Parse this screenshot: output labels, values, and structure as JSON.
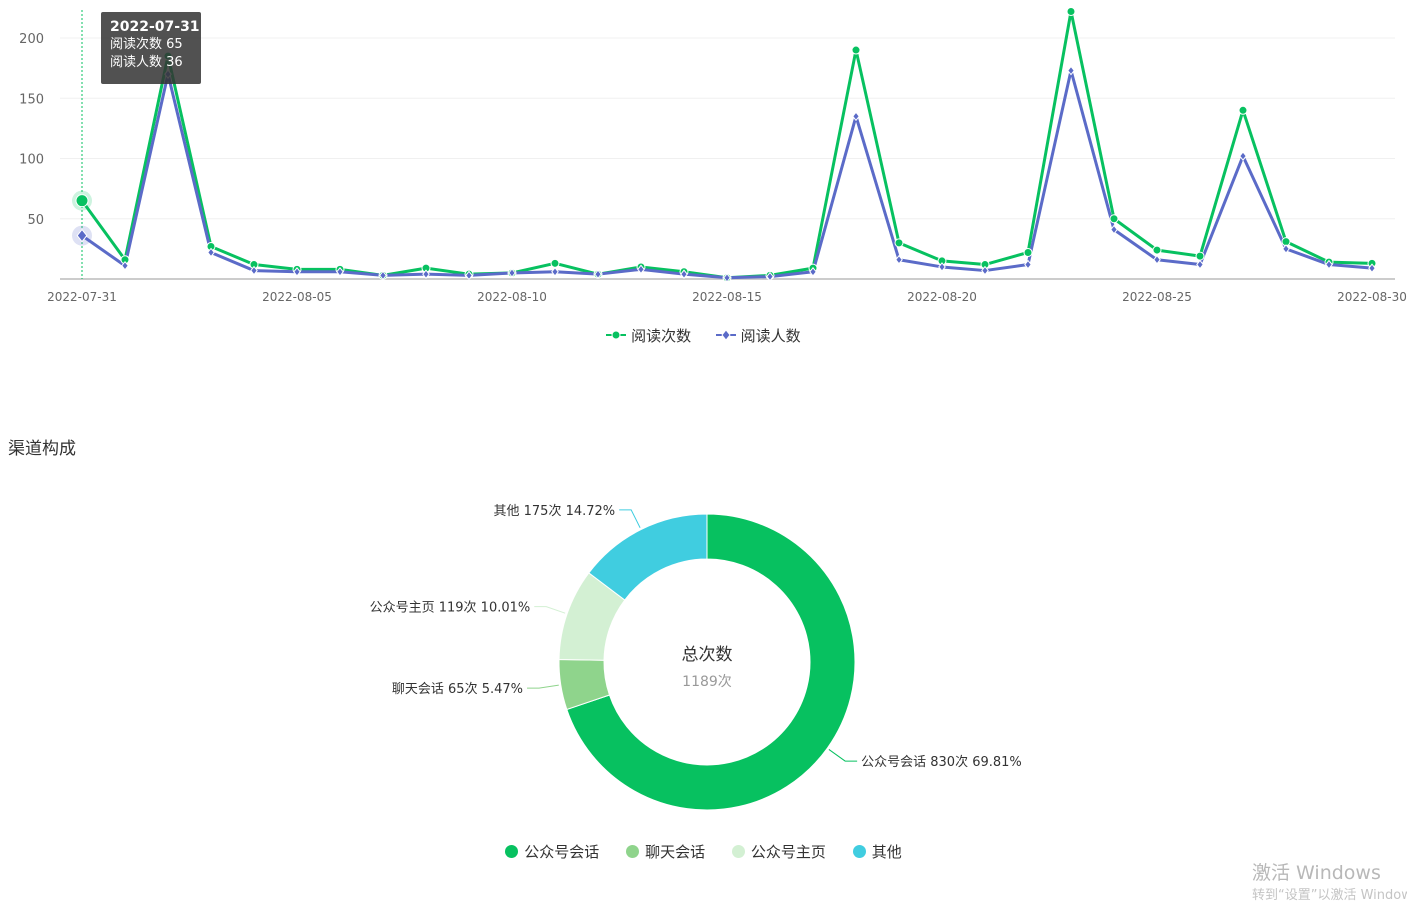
{
  "chart_data": [
    {
      "type": "line",
      "x": [
        "2022-07-31",
        "2022-08-01",
        "2022-08-02",
        "2022-08-03",
        "2022-08-04",
        "2022-08-05",
        "2022-08-06",
        "2022-08-07",
        "2022-08-08",
        "2022-08-09",
        "2022-08-10",
        "2022-08-11",
        "2022-08-12",
        "2022-08-13",
        "2022-08-14",
        "2022-08-15",
        "2022-08-16",
        "2022-08-17",
        "2022-08-18",
        "2022-08-19",
        "2022-08-20",
        "2022-08-21",
        "2022-08-22",
        "2022-08-23",
        "2022-08-24",
        "2022-08-25",
        "2022-08-26",
        "2022-08-27",
        "2022-08-28",
        "2022-08-29",
        "2022-08-30"
      ],
      "x_tick_labels": [
        "2022-07-31",
        "2022-08-05",
        "2022-08-10",
        "2022-08-15",
        "2022-08-20",
        "2022-08-25",
        "2022-08-30"
      ],
      "y_tick_labels": [
        "50",
        "100",
        "150",
        "200"
      ],
      "ylim": [
        0,
        220
      ],
      "grid": true,
      "legend_position": "bottom",
      "series": [
        {
          "name": "阅读次数",
          "color": "#07c160",
          "values": [
            65,
            16,
            185,
            27,
            12,
            8,
            8,
            3,
            9,
            4,
            5,
            13,
            4,
            10,
            6,
            1,
            3,
            9,
            190,
            30,
            15,
            12,
            22,
            222,
            50,
            24,
            19,
            140,
            31,
            14,
            13
          ]
        },
        {
          "name": "阅读人数",
          "color": "#5b6bc8",
          "values": [
            36,
            11,
            170,
            22,
            7,
            6,
            6,
            3,
            4,
            3,
            5,
            6,
            4,
            8,
            4,
            1,
            2,
            6,
            135,
            16,
            10,
            7,
            12,
            173,
            41,
            16,
            12,
            102,
            25,
            12,
            9
          ]
        }
      ],
      "tooltip": {
        "date": "2022-07-31",
        "rows": [
          {
            "label": "阅读次数",
            "value": "65"
          },
          {
            "label": "阅读人数",
            "value": "36"
          }
        ]
      }
    },
    {
      "type": "pie",
      "title": "渠道构成",
      "center_label": "总次数",
      "center_value": "1189次",
      "legend_position": "bottom",
      "slices": [
        {
          "name": "公众号会话",
          "value": 830,
          "label": "公众号会话 830次 69.81%",
          "color": "#07c160"
        },
        {
          "name": "聊天会话",
          "value": 65,
          "label": "聊天会话 65次 5.47%",
          "color": "#8fd48c"
        },
        {
          "name": "公众号主页",
          "value": 119,
          "label": "公众号主页 119次 10.01%",
          "color": "#d3f0d3"
        },
        {
          "name": "其他",
          "value": 175,
          "label": "其他 175次 14.72%",
          "color": "#40cde0"
        }
      ]
    }
  ],
  "watermark": {
    "line1": "激活 Windows",
    "line2": "转到“设置”以激活 Windows"
  }
}
